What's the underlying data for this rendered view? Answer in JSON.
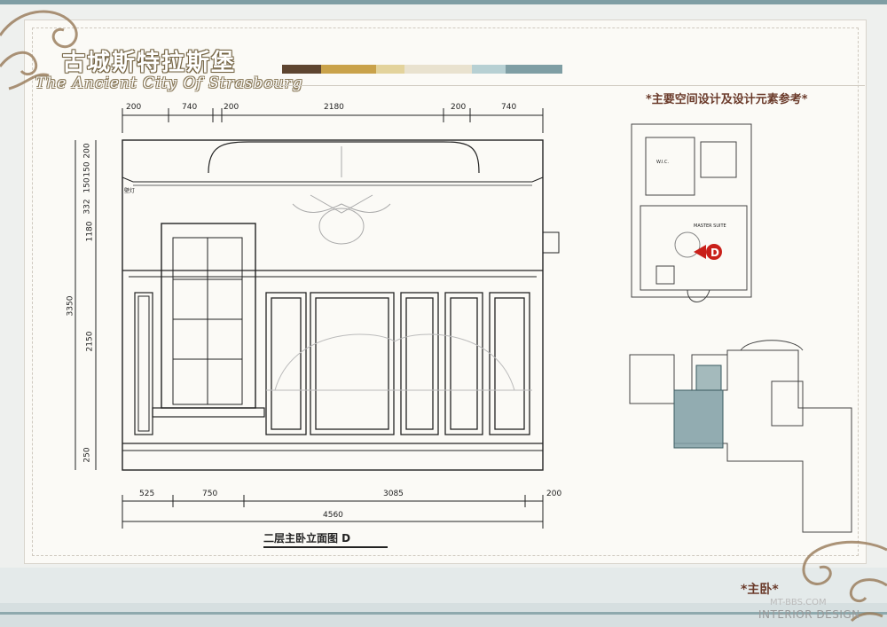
{
  "header": {
    "title_cn": "古城斯特拉斯堡",
    "title_en": "The Ancient City Of Strasbourg",
    "palette": [
      "#5e4530",
      "#c9a24a",
      "#e3d39c",
      "#e9e2cf",
      "#b7d0d3",
      "#7f9ea4"
    ]
  },
  "reference": {
    "title": "*主要空间设计及设计元素参考*",
    "plan_room_labels": [
      "W.I.C.",
      "MASTER SUITE"
    ],
    "marker_letter": "D"
  },
  "elevation": {
    "caption": "二层主卧立面图 D",
    "lamp_label": "壁灯",
    "top_dims": [
      "200",
      "740",
      "200",
      "2180",
      "200",
      "740"
    ],
    "left_dims": [
      "200",
      "150",
      "150",
      "332",
      "1180"
    ],
    "left_big_dims": [
      "3350",
      "2150",
      "250"
    ],
    "bottom_dims": [
      "525",
      "750",
      "3085",
      "200"
    ],
    "bottom_total": "4560"
  },
  "footer": {
    "room_label": "*主卧*",
    "watermark_site": "MT-BBS.COM",
    "watermark_brand": "INTERIOR DESIGN"
  }
}
